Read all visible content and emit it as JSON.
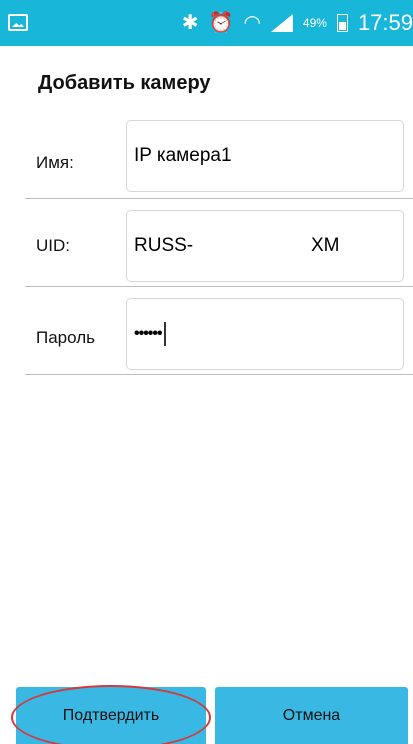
{
  "status_bar": {
    "battery_percent": "49%",
    "time": "17:59",
    "icons": [
      "gallery-icon",
      "bluetooth-icon",
      "alarm-icon",
      "wifi-icon",
      "signal-icon",
      "battery-icon"
    ]
  },
  "dialog": {
    "title": "Добавить камеру",
    "fields": {
      "name": {
        "label": "Имя:",
        "value": "IP камера1"
      },
      "uid": {
        "label": "UID:",
        "value_prefix": "RUSS-",
        "value_suffix": "XM"
      },
      "password": {
        "label": "Пароль",
        "value": "••••••"
      }
    },
    "buttons": {
      "confirm": "Подтвердить",
      "cancel": "Отмена"
    }
  },
  "colors": {
    "status_bar": "#18b6d8",
    "button": "#3ab8e4",
    "highlight": "#d43a3a"
  }
}
